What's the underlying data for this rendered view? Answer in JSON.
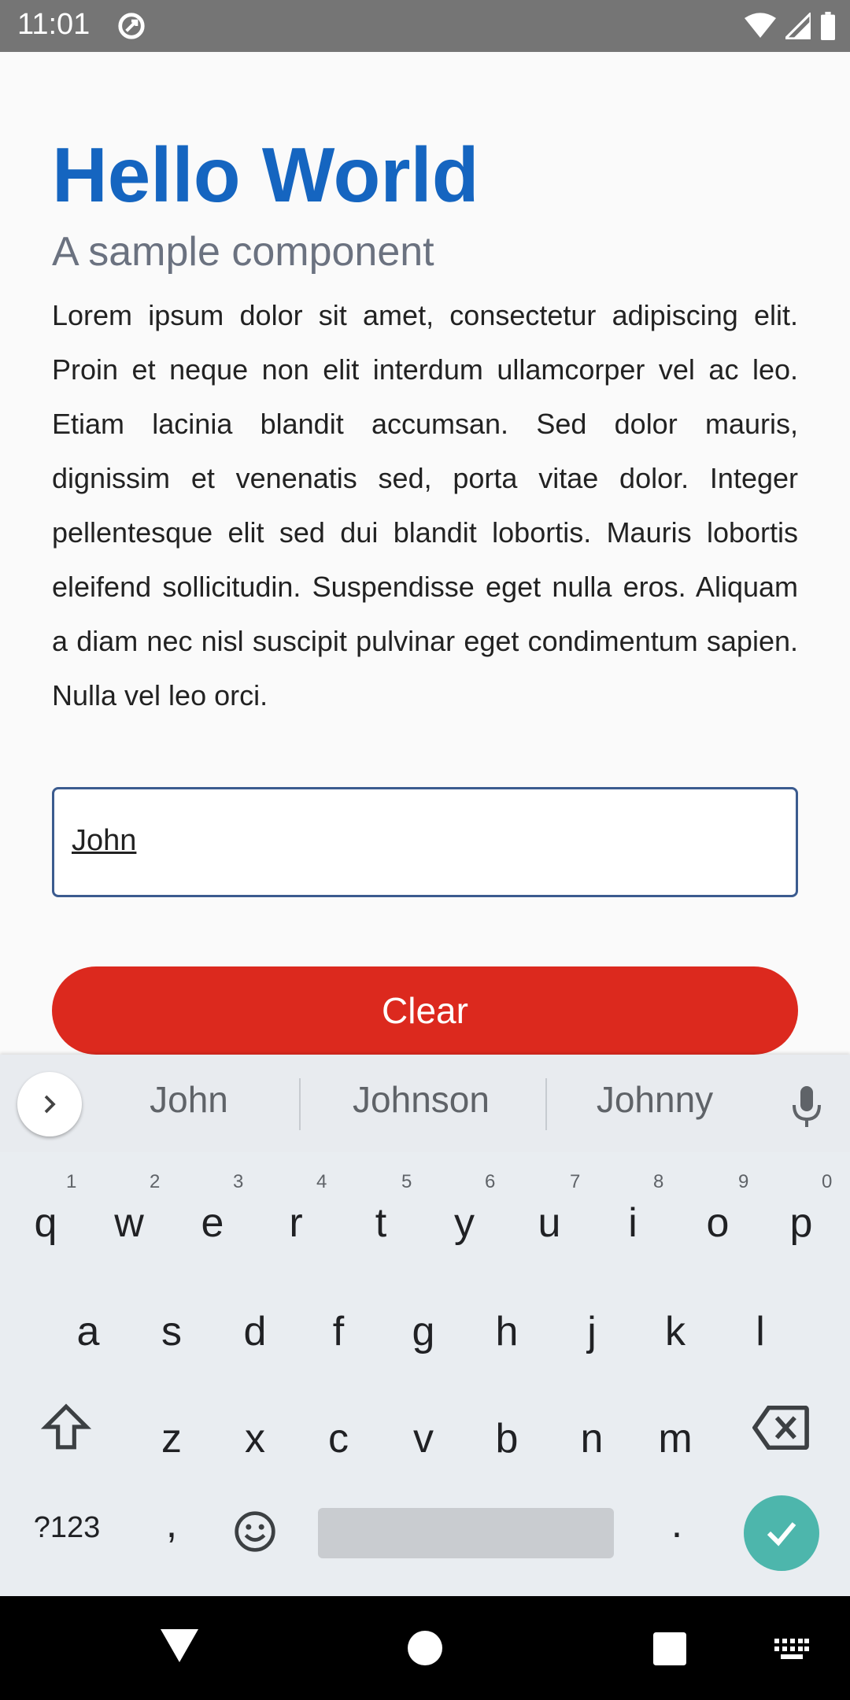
{
  "status_bar": {
    "time": "11:01"
  },
  "content": {
    "title": "Hello World",
    "subtitle": "A sample component",
    "body": "Lorem ipsum dolor sit amet, consectetur adipiscing elit. Proin et neque non elit interdum ullamcorper vel ac leo. Etiam lacinia blandit accumsan. Sed dolor mauris, dignissim et venenatis sed, porta vitae dolor. Integer pellentesque elit sed dui blandit lobortis. Mauris lobortis eleifend sollicitudin. Suspendisse eget nulla eros. Aliquam a diam nec nisl suscipit pulvinar eget condimentum sapien. Nulla vel leo orci."
  },
  "input": {
    "value": "John"
  },
  "clear_button": {
    "label": "Clear",
    "color": "#dc291e"
  },
  "keyboard": {
    "suggestions": [
      "John",
      "Johnson",
      "Johnny"
    ],
    "row1": [
      "q",
      "w",
      "e",
      "r",
      "t",
      "y",
      "u",
      "i",
      "o",
      "p"
    ],
    "row1_numbers": [
      "1",
      "2",
      "3",
      "4",
      "5",
      "6",
      "7",
      "8",
      "9",
      "0"
    ],
    "row2": [
      "a",
      "s",
      "d",
      "f",
      "g",
      "h",
      "j",
      "k",
      "l"
    ],
    "row3": [
      "z",
      "x",
      "c",
      "v",
      "b",
      "n",
      "m"
    ],
    "symbols_key": "?123",
    "comma_key": ",",
    "period_key": ".",
    "enter_color": "#4db6ac"
  },
  "colors": {
    "title": "#1565c0",
    "accent": "#dc291e"
  }
}
